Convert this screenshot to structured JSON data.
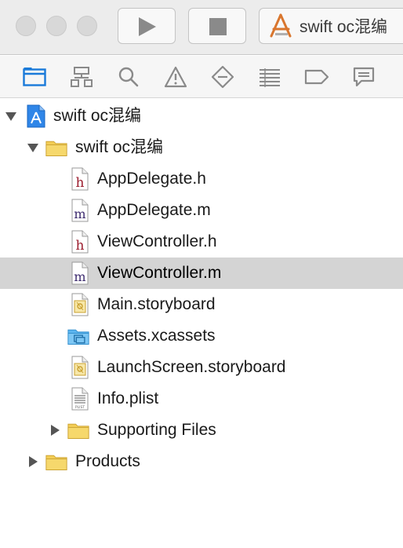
{
  "toolbar": {
    "run_label": "Run",
    "stop_label": "Stop",
    "scheme_name": "swift oc混编"
  },
  "navigator": {
    "tabs": [
      {
        "name": "project-navigator-icon",
        "selected": true
      },
      {
        "name": "symbol-navigator-icon",
        "selected": false
      },
      {
        "name": "find-navigator-icon",
        "selected": false
      },
      {
        "name": "issue-navigator-icon",
        "selected": false
      },
      {
        "name": "test-navigator-icon",
        "selected": false
      },
      {
        "name": "debug-navigator-icon",
        "selected": false
      },
      {
        "name": "breakpoint-navigator-icon",
        "selected": false
      },
      {
        "name": "report-navigator-icon",
        "selected": false
      }
    ]
  },
  "tree": {
    "project": "swift oc混编",
    "group": "swift oc混编",
    "files": {
      "app_delegate_h": "AppDelegate.h",
      "app_delegate_m": "AppDelegate.m",
      "view_controller_h": "ViewController.h",
      "view_controller_m": "ViewController.m",
      "main_storyboard": "Main.storyboard",
      "assets": "Assets.xcassets",
      "launch_storyboard": "LaunchScreen.storyboard",
      "info_plist": "Info.plist"
    },
    "supporting_files": "Supporting Files",
    "products": "Products",
    "selected": "ViewController.m",
    "plist_badge": "PLIST"
  },
  "colors": {
    "selection": "#d4d4d4",
    "accent_blue": "#1a7ad9",
    "folder_yellow": "#f3cd55",
    "header_red": "#9b1c2d",
    "impl_purple": "#3c2a6e"
  }
}
